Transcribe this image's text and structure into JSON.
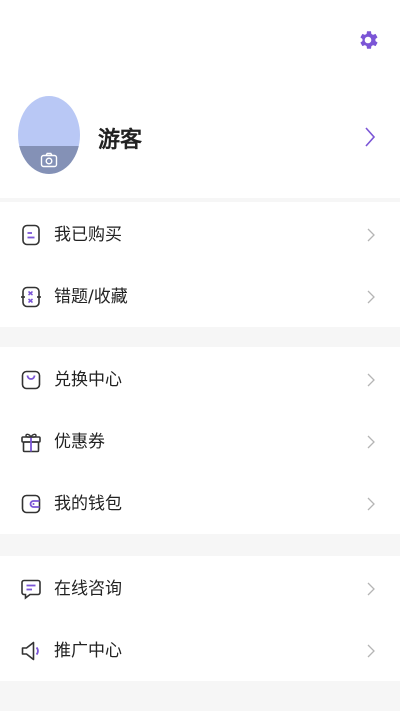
{
  "header": {
    "settings_icon": "gear-icon",
    "accent": "#7b55d6"
  },
  "profile": {
    "name": "游客",
    "avatar_icon": "camera-icon",
    "avatar_color": "#b9c8f5"
  },
  "menu": {
    "group1": [
      {
        "label": "我已购买",
        "icon": "order-list-icon"
      },
      {
        "label": "错题/收藏",
        "icon": "wrong-question-icon"
      }
    ],
    "group2": [
      {
        "label": "兑换中心",
        "icon": "shopping-bag-icon"
      },
      {
        "label": "优惠券",
        "icon": "gift-icon"
      },
      {
        "label": "我的钱包",
        "icon": "wallet-icon"
      }
    ],
    "group3": [
      {
        "label": "在线咨询",
        "icon": "chat-icon"
      },
      {
        "label": "推广中心",
        "icon": "megaphone-icon"
      }
    ]
  }
}
